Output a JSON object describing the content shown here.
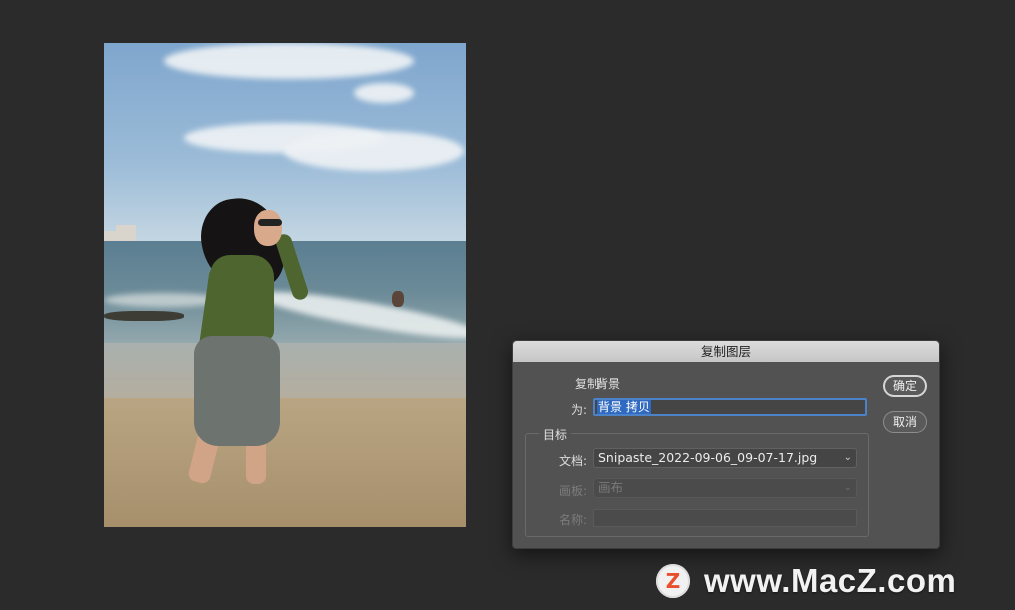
{
  "dialog": {
    "title": "复制图层",
    "copy_label": "复制:",
    "copy_value": "背景",
    "as_label": "为:",
    "as_value": "背景 拷贝",
    "target_label": "目标",
    "document_label": "文档:",
    "document_value": "Snipaste_2022-09-06_09-07-17.jpg",
    "artboard_label": "画板:",
    "artboard_value": "画布",
    "name_label": "名称:",
    "name_value": "",
    "ok_label": "确定",
    "cancel_label": "取消"
  },
  "watermark": {
    "logo_letter": "Z",
    "text": "www.MacZ.com"
  },
  "colors": {
    "canvas_bg": "#2b2b2b",
    "dialog_bg": "#525252",
    "selection": "#2f6ac0",
    "focus_ring": "#4c82c8",
    "logo_accent": "#e8502d"
  },
  "icons": {
    "dropdown": "chevron-down-icon"
  }
}
